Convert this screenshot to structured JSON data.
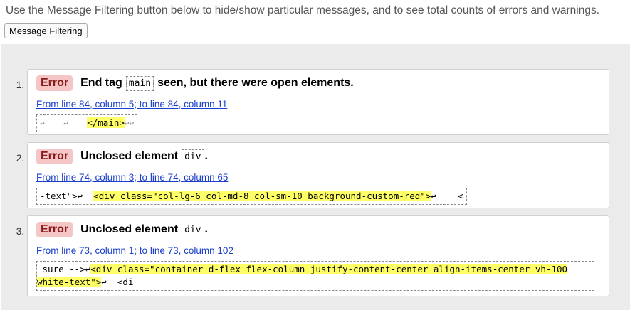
{
  "intro_text": "Use the Message Filtering button below to hide/show particular messages, and to see total counts of errors and warnings.",
  "filter_button_label": "Message Filtering",
  "messages": [
    {
      "number": "1.",
      "type": "Error",
      "pre": "End tag",
      "code": "main",
      "post": "seen, but there were open elements.",
      "location": "From line 84, column 5; to line 84, column 11",
      "extract_before": "↩    ↩    ",
      "extract_highlight": "</main>",
      "extract_after": "↩↩"
    },
    {
      "number": "2.",
      "type": "Error",
      "pre": "Unclosed element",
      "code": "div",
      "post": ".",
      "location": "From line 74, column 3; to line 74, column 65",
      "extract_before": "-text\">↩  ",
      "extract_highlight": "<div class=\"col-lg-6 col-md-8 col-sm-10 background-custom-red\">",
      "extract_after": "↩    <"
    },
    {
      "number": "3.",
      "type": "Error",
      "pre": "Unclosed element",
      "code": "div",
      "post": ".",
      "location": "From line 73, column 1; to line 73, column 102",
      "extract_before": " sure -->↩",
      "extract_highlight_line1": "<div class=\"container d-flex flex-column justify-content-center align-items-center vh-100",
      "extract_highlight_line2": "white-text\">",
      "extract_after": "↩  <di"
    }
  ]
}
